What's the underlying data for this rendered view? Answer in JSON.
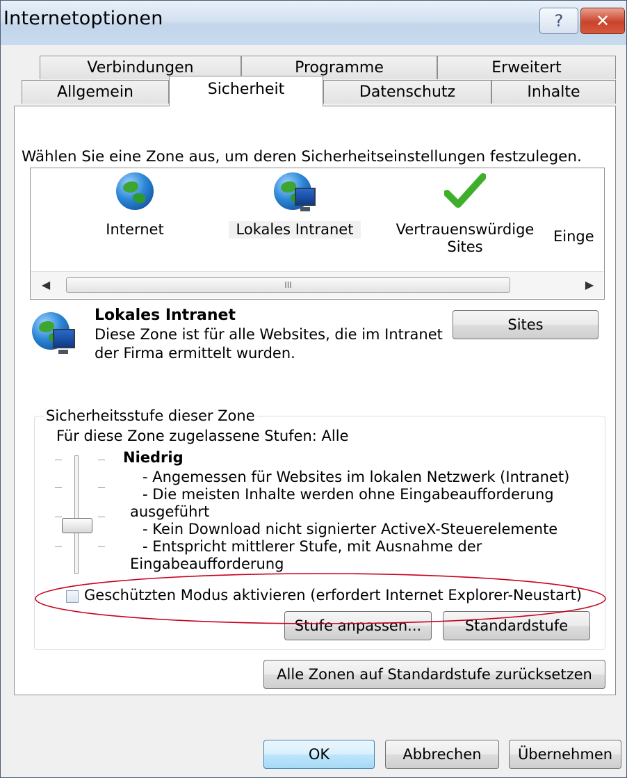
{
  "window": {
    "title": "Internetoptionen",
    "help_label": "?",
    "close_label": "✕"
  },
  "tabs": {
    "row1": [
      "Verbindungen",
      "Programme",
      "Erweitert"
    ],
    "row2": [
      "Allgemein",
      "Sicherheit",
      "Datenschutz",
      "Inhalte"
    ],
    "active": "Sicherheit"
  },
  "zones": {
    "prompt": "Wählen Sie eine Zone aus, um deren Sicherheitseinstellungen festzulegen.",
    "items": [
      {
        "label": "Internet",
        "icon": "globe-icon"
      },
      {
        "label": "Lokales Intranet",
        "icon": "intranet-globe-monitor-icon",
        "selected": true
      },
      {
        "label_line1": "Vertrauenswürdige",
        "label_line2": "Sites",
        "icon": "green-check-icon"
      },
      {
        "label": "Einge",
        "icon": "restricted-icon"
      }
    ],
    "scroll_grip": "III"
  },
  "zone_info": {
    "title": "Lokales Intranet",
    "description": "Diese Zone ist für alle Websites, die im Intranet der Firma ermittelt wurden.",
    "sites_button": "Sites"
  },
  "security_level": {
    "group_label": "Sicherheitsstufe dieser Zone",
    "allowed_levels": "Für diese Zone zugelassene Stufen: Alle",
    "level_name": "Niedrig",
    "bullets": [
      "- Angemessen für Websites im lokalen Netzwerk (Intranet)",
      "- Die meisten Inhalte werden ohne Eingabeaufforderung",
      "ausgeführt",
      "- Kein Download nicht signierter ActiveX-Steuerelemente",
      "- Entspricht mittlerer Stufe, mit Ausnahme der",
      "Eingabeaufforderung"
    ],
    "slider_level": 0.33,
    "protected_mode_label": "Geschützten Modus aktivieren (erfordert Internet Explorer-Neustart)",
    "protected_mode_checked": false,
    "custom_level_button": "Stufe anpassen...",
    "default_level_button": "Standardstufe"
  },
  "reset_all_button": "Alle Zonen auf Standardstufe zurücksetzen",
  "footer": {
    "ok": "OK",
    "cancel": "Abbrechen",
    "apply": "Übernehmen"
  },
  "colors": {
    "annotation_ellipse": "#c8001e",
    "title_gradient": "#c2d5ea"
  }
}
